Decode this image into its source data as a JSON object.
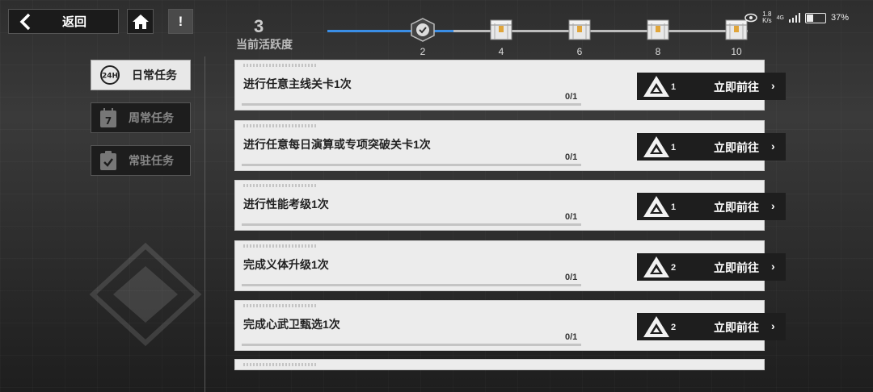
{
  "nav": {
    "back_label": "返回",
    "back_badge": "4:3"
  },
  "activity": {
    "current_value": "3",
    "current_label": "当前活跃度",
    "progress_fraction": 0.3,
    "milestones": [
      {
        "value": "2",
        "state": "claimed"
      },
      {
        "value": "4",
        "state": "locked"
      },
      {
        "value": "6",
        "state": "locked"
      },
      {
        "value": "8",
        "state": "locked"
      },
      {
        "value": "10",
        "state": "locked"
      }
    ]
  },
  "status_bar": {
    "speed_value": "1.8",
    "speed_unit": "K/s",
    "network": "4G",
    "battery": "37%",
    "battery_level": 0.37
  },
  "sidebar": {
    "tabs": [
      {
        "icon_text": "24H",
        "label": "日常任务",
        "active": true
      },
      {
        "icon_text": "7",
        "label": "周常任务",
        "active": false
      },
      {
        "icon_text": "",
        "label": "常驻任务",
        "active": false
      }
    ]
  },
  "tasks": [
    {
      "name": "进行任意主线关卡1次",
      "progress": "0/1",
      "progress_fraction": 0,
      "reward_count": "1",
      "go_label": "立即前往"
    },
    {
      "name": "进行任意每日演算或专项突破关卡1次",
      "progress": "0/1",
      "progress_fraction": 0,
      "reward_count": "1",
      "go_label": "立即前往"
    },
    {
      "name": "进行性能考级1次",
      "progress": "0/1",
      "progress_fraction": 0,
      "reward_count": "1",
      "go_label": "立即前往"
    },
    {
      "name": "完成义体升级1次",
      "progress": "0/1",
      "progress_fraction": 0,
      "reward_count": "2",
      "go_label": "立即前往"
    },
    {
      "name": "完成心武卫甄选1次",
      "progress": "0/1",
      "progress_fraction": 0,
      "reward_count": "2",
      "go_label": "立即前往"
    }
  ],
  "colors": {
    "accent": "#3a8ee6",
    "card_bg": "#ececec",
    "button_bg": "#1e1e1e"
  }
}
